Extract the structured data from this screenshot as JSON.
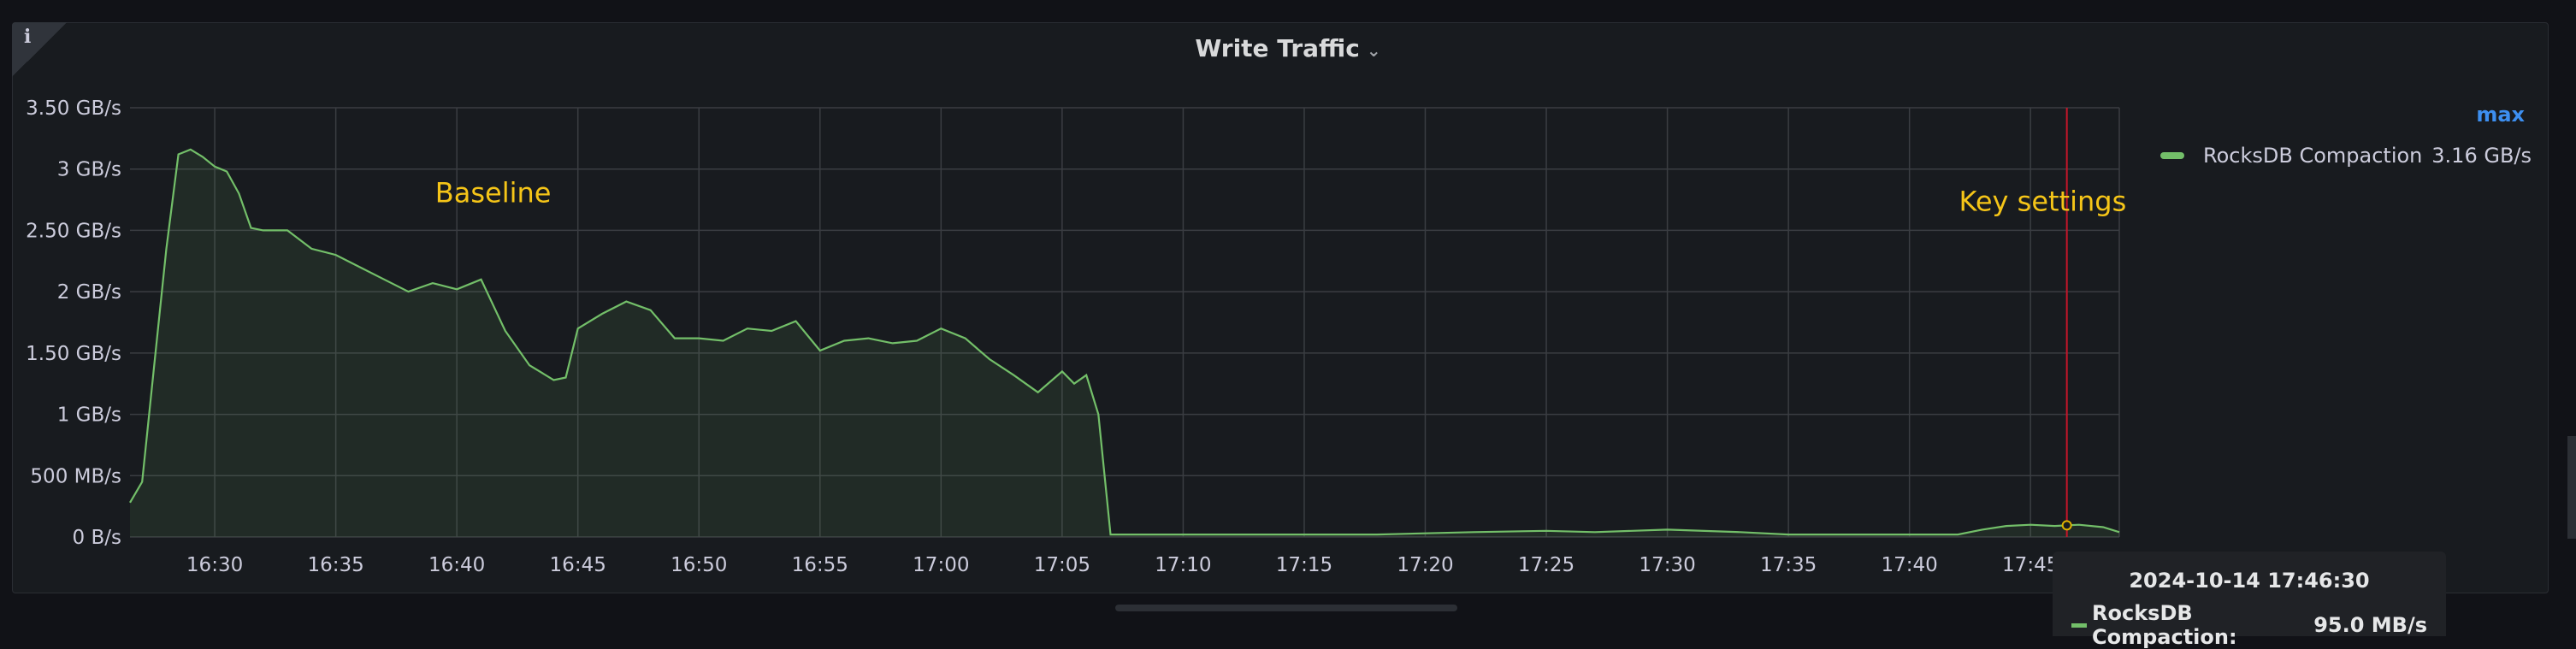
{
  "panel": {
    "title": "Write Traffic",
    "info_icon": "info-icon",
    "title_chevron_icon": "chevron-down-icon"
  },
  "legend": {
    "header": "max",
    "items": [
      {
        "name": "RocksDB Compaction",
        "max": "3.16 GB/s",
        "color": "#73bf69"
      }
    ]
  },
  "tooltip": {
    "time": "2024-10-14 17:46:30",
    "series_label": "RocksDB Compaction:",
    "value": "95.0 MB/s"
  },
  "chart_data": {
    "type": "area",
    "ylim": [
      0,
      3.5
    ],
    "y_ticks": [
      {
        "value": 0,
        "label": "0 B/s"
      },
      {
        "value": 0.5,
        "label": "500 MB/s"
      },
      {
        "value": 1,
        "label": "1 GB/s"
      },
      {
        "value": 1.5,
        "label": "1.50 GB/s"
      },
      {
        "value": 2,
        "label": "2 GB/s"
      },
      {
        "value": 2.5,
        "label": "2.50 GB/s"
      },
      {
        "value": 3,
        "label": "3 GB/s"
      },
      {
        "value": 3.5,
        "label": "3.50 GB/s"
      }
    ],
    "x_ticks": [
      "16:30",
      "16:35",
      "16:40",
      "16:45",
      "16:50",
      "16:55",
      "17:00",
      "17:05",
      "17:10",
      "17:15",
      "17:20",
      "17:25",
      "17:30",
      "17:35",
      "17:40",
      "17:45"
    ],
    "xlim": [
      "16:26:30",
      "17:48:40"
    ],
    "grid": true,
    "legend_position": "right",
    "crosshair_time": "17:46:30",
    "annotations": [
      {
        "text": "Baseline",
        "time": "16:41:30",
        "y": 2.73
      },
      {
        "text": "Key settings",
        "time": "17:45:30",
        "y": 2.66
      }
    ],
    "series": [
      {
        "name": "RocksDB Compaction",
        "color": "#73bf69",
        "x": [
          "16:26:30",
          "16:27:00",
          "16:27:30",
          "16:28:00",
          "16:28:30",
          "16:29:00",
          "16:29:30",
          "16:30:00",
          "16:30:30",
          "16:31:00",
          "16:31:30",
          "16:32:00",
          "16:33:00",
          "16:34:00",
          "16:35:00",
          "16:36:00",
          "16:37:00",
          "16:38:00",
          "16:39:00",
          "16:40:00",
          "16:41:00",
          "16:42:00",
          "16:43:00",
          "16:44:00",
          "16:44:30",
          "16:45:00",
          "16:46:00",
          "16:47:00",
          "16:48:00",
          "16:49:00",
          "16:50:00",
          "16:51:00",
          "16:52:00",
          "16:53:00",
          "16:54:00",
          "16:55:00",
          "16:56:00",
          "16:57:00",
          "16:58:00",
          "16:59:00",
          "17:00:00",
          "17:01:00",
          "17:02:00",
          "17:03:00",
          "17:04:00",
          "17:05:00",
          "17:05:30",
          "17:06:00",
          "17:06:30",
          "17:07:00",
          "17:10:00",
          "17:15:00",
          "17:18:00",
          "17:20:00",
          "17:22:00",
          "17:25:00",
          "17:27:00",
          "17:30:00",
          "17:33:00",
          "17:35:00",
          "17:40:00",
          "17:42:00",
          "17:43:00",
          "17:44:00",
          "17:45:00",
          "17:46:00",
          "17:46:30",
          "17:47:00",
          "17:48:00",
          "17:48:40"
        ],
        "y": [
          0.28,
          0.45,
          1.4,
          2.35,
          3.12,
          3.16,
          3.1,
          3.02,
          2.98,
          2.8,
          2.52,
          2.5,
          2.5,
          2.35,
          2.3,
          2.2,
          2.1,
          2.0,
          2.07,
          2.02,
          2.1,
          1.68,
          1.4,
          1.28,
          1.3,
          1.7,
          1.82,
          1.92,
          1.85,
          1.62,
          1.62,
          1.6,
          1.7,
          1.68,
          1.76,
          1.52,
          1.6,
          1.62,
          1.58,
          1.6,
          1.7,
          1.62,
          1.45,
          1.32,
          1.18,
          1.35,
          1.25,
          1.32,
          1.0,
          0.02,
          0.02,
          0.02,
          0.02,
          0.03,
          0.04,
          0.05,
          0.04,
          0.06,
          0.04,
          0.02,
          0.02,
          0.02,
          0.06,
          0.09,
          0.1,
          0.09,
          0.095,
          0.1,
          0.08,
          0.04
        ]
      }
    ]
  }
}
